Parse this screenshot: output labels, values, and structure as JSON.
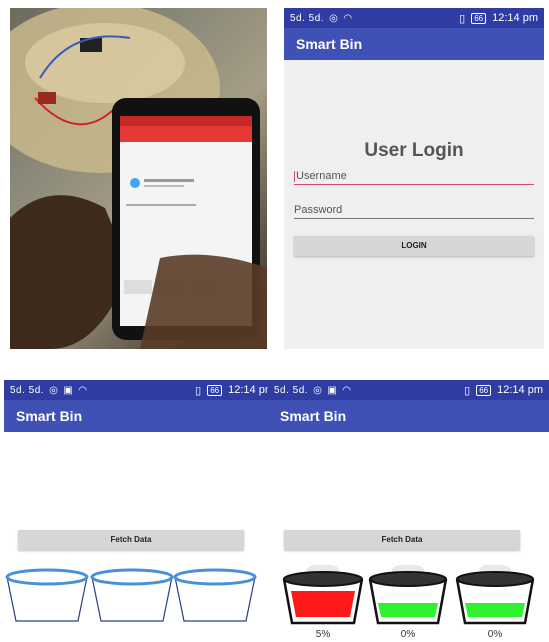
{
  "status_bar": {
    "signal": "5d. 5d.",
    "time": "12:14 pm",
    "battery": "66"
  },
  "login_screen": {
    "app_title": "Smart Bin",
    "heading": "User Login",
    "username_placeholder": "Username",
    "password_placeholder": "Password",
    "login_button": "LOGIN"
  },
  "fetch_screen_empty": {
    "app_title": "Smart Bin",
    "fetch_button": "Fetch Data",
    "bins": [
      {
        "level": 0
      },
      {
        "level": 0
      },
      {
        "level": 0
      }
    ]
  },
  "fetch_screen_filled": {
    "app_title": "Smart Bin",
    "fetch_button": "Fetch Data",
    "bins": [
      {
        "label": "5%",
        "fill_color": "#ff1a1a"
      },
      {
        "label": "0%",
        "fill_color": "#2ef22e"
      },
      {
        "label": "0%",
        "fill_color": "#2ef22e"
      }
    ]
  },
  "colors": {
    "app_bar": "#3f51b5",
    "status_bar": "#2f3ca3",
    "accent": "#e0407a"
  }
}
